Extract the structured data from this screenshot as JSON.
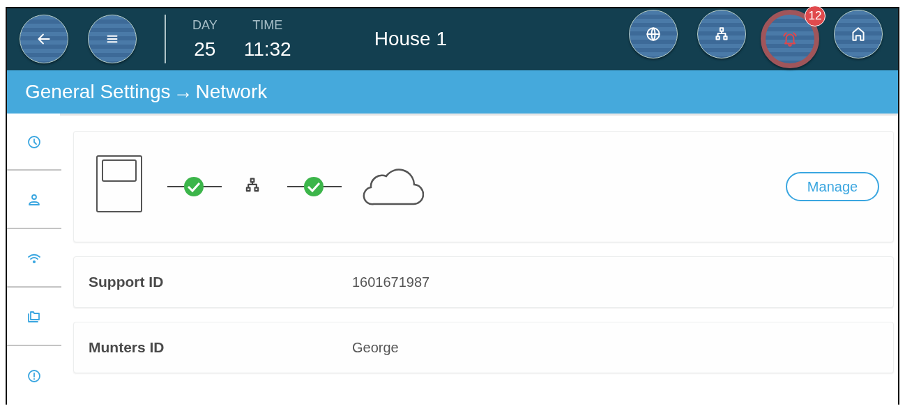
{
  "header": {
    "day_label": "DAY",
    "day": "25",
    "time_label": "TIME",
    "time": "11:32",
    "title": "House 1",
    "left_buttons": [
      {
        "kind": "back"
      },
      {
        "kind": "menu"
      }
    ],
    "right_buttons": [
      {
        "kind": "globe"
      },
      {
        "kind": "network"
      },
      {
        "kind": "alarm",
        "badge": "12",
        "alert": true
      },
      {
        "kind": "home"
      }
    ]
  },
  "breadcrumb": {
    "parent": "General Settings",
    "arrow": "→",
    "current": "Network"
  },
  "sidebar": {
    "items": [
      {
        "kind": "clock"
      },
      {
        "kind": "user"
      },
      {
        "kind": "wifi"
      },
      {
        "kind": "folders"
      },
      {
        "kind": "info"
      }
    ]
  },
  "connection": {
    "links": [
      {
        "connected": true
      },
      {
        "connected": true
      }
    ],
    "button": "Manage"
  },
  "fields": [
    {
      "label": "Support ID",
      "value": "1601671987"
    },
    {
      "label": "Munters ID",
      "value": "George"
    }
  ]
}
